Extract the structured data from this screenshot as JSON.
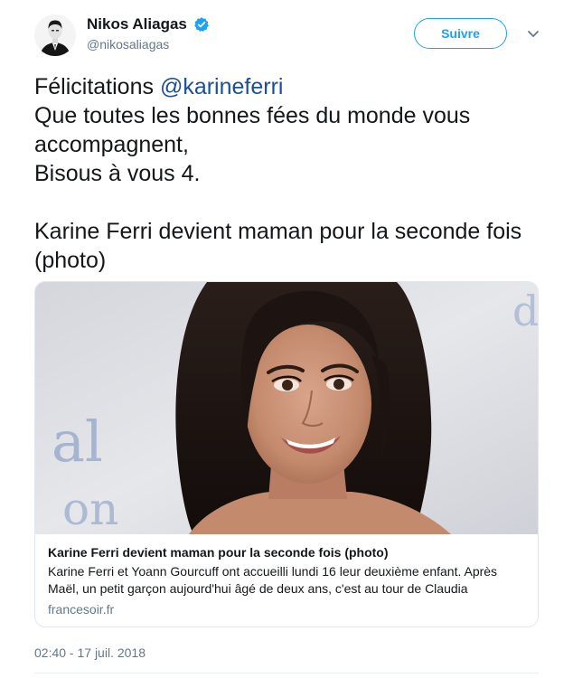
{
  "author": {
    "display_name": "Nikos Aliagas",
    "handle": "@nikosaliagas",
    "verified_icon": "verified-badge-icon",
    "avatar_icon": "avatar-silhouette"
  },
  "follow_button": {
    "label": "Suivre"
  },
  "menu_icon": "chevron-down-icon",
  "tweet": {
    "line1_prefix": "Félicitations ",
    "mention": "@karineferri",
    "line2": "Que toutes les bonnes fées du monde vous accompagnent,",
    "line3": "Bisous à vous 4.",
    "line4": "Karine Ferri devient maman pour la seconde fois (photo)"
  },
  "card": {
    "title": "Karine Ferri devient maman pour la seconde fois (photo)",
    "description": "Karine Ferri et Yoann Gourcuff ont accueilli lundi 16 leur deuxième enfant. Après Maël, un petit garçon aujourd'hui âgé de deux ans, c'est au tour de Claudia",
    "domain": "francesoir.fr",
    "background_text_1": "d",
    "background_text_2": "al",
    "background_text_3": "on"
  },
  "timestamp": "02:40 - 17 juil. 2018",
  "colors": {
    "accent": "#1da1f2",
    "mention": "#1b4f9b",
    "secondary_text": "#657786",
    "border": "#e1e8ed"
  }
}
